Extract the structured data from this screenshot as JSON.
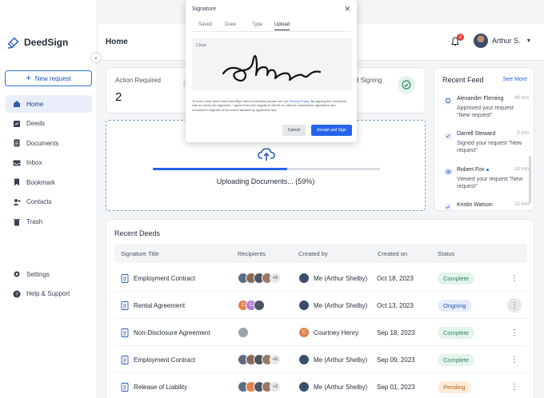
{
  "app": {
    "name": "DeedSign"
  },
  "sidebar": {
    "new_request": "New request",
    "items": [
      {
        "label": "Home",
        "icon": "home-icon"
      },
      {
        "label": "Deeds",
        "icon": "deeds-icon"
      },
      {
        "label": "Documents",
        "icon": "documents-icon"
      },
      {
        "label": "Inbox",
        "icon": "inbox-icon"
      },
      {
        "label": "Bookmark",
        "icon": "bookmark-icon"
      },
      {
        "label": "Contacts",
        "icon": "contacts-icon"
      },
      {
        "label": "Trash",
        "icon": "trash-icon"
      }
    ],
    "bottom": [
      {
        "label": "Settings",
        "icon": "gear-icon"
      },
      {
        "label": "Help & Support",
        "icon": "help-icon"
      }
    ]
  },
  "header": {
    "title": "Home",
    "notifications": "2",
    "user_name": "Arthur S."
  },
  "stats": {
    "action_required_label": "Action Required",
    "action_required_value": "2",
    "signing_label": "d Signing"
  },
  "upload": {
    "progress": 0.59,
    "text": "Uploading Documents... (59%)"
  },
  "feed": {
    "title": "Recent Feed",
    "see_more": "See More",
    "items": [
      {
        "name": "Alexander Fleming",
        "time": "49 min",
        "desc": "Approved your request \"New request\""
      },
      {
        "name": "Darrell Steward",
        "time": "5 min",
        "desc": "Signed your request \"New request\""
      },
      {
        "name": "Robert Fox",
        "time": "18 min",
        "desc": "Viewed your request \"New request\""
      },
      {
        "name": "Kristin Watson",
        "time": "25 min",
        "desc": ""
      }
    ]
  },
  "deeds": {
    "title": "Recent Deeds",
    "columns": [
      "Signature Title",
      "Recipients",
      "Created by",
      "Created on",
      "Status"
    ],
    "rows": [
      {
        "title": "Employment Contract",
        "more": "+5",
        "created_by": "Me (Arthur Shelby)",
        "creator_initial": "",
        "date": "Oct 18, 2023",
        "status": "Complete"
      },
      {
        "title": "Rental Agreement",
        "more": "",
        "created_by": "Me (Arthur Shelby)",
        "creator_initial": "",
        "date": "Oct 13, 2023",
        "status": "Ongoing"
      },
      {
        "title": "Non-Disclosure Agreement",
        "more": "",
        "created_by": "Courtney Henry",
        "creator_initial": "C",
        "date": "Sep 18, 2023",
        "status": "Complete"
      },
      {
        "title": "Employment Contract",
        "more": "+5",
        "created_by": "Me (Arthur Shelby)",
        "creator_initial": "",
        "date": "Sep 09, 2023",
        "status": "Complete"
      },
      {
        "title": "Release of Liability",
        "more": "+2",
        "created_by": "Me (Arthur Shelby)",
        "creator_initial": "",
        "date": "Sep 01, 2023",
        "status": "Pending"
      }
    ],
    "row2_initials": [
      "C",
      "C"
    ]
  },
  "modal": {
    "title": "Signature",
    "tabs": [
      "Saved",
      "Draw",
      "Type",
      "Upload"
    ],
    "active_tab": "Upload",
    "clear": "Clear",
    "note_before": "To learn more about how DeedSign uses information please see our ",
    "note_link": "Privacy Policy",
    "note_after": ". By signing this document with an electronic signature, I agree that such signature will be as valid as handwritten signatures and considered originals to the extent allowed by applicable law.",
    "cancel": "Cancel",
    "accept": "Accept and Sign"
  },
  "colors": {
    "accent": "#2563eb",
    "complete": "#2f855a",
    "ongoing": "#2b5bb8",
    "pending": "#b7641d"
  }
}
